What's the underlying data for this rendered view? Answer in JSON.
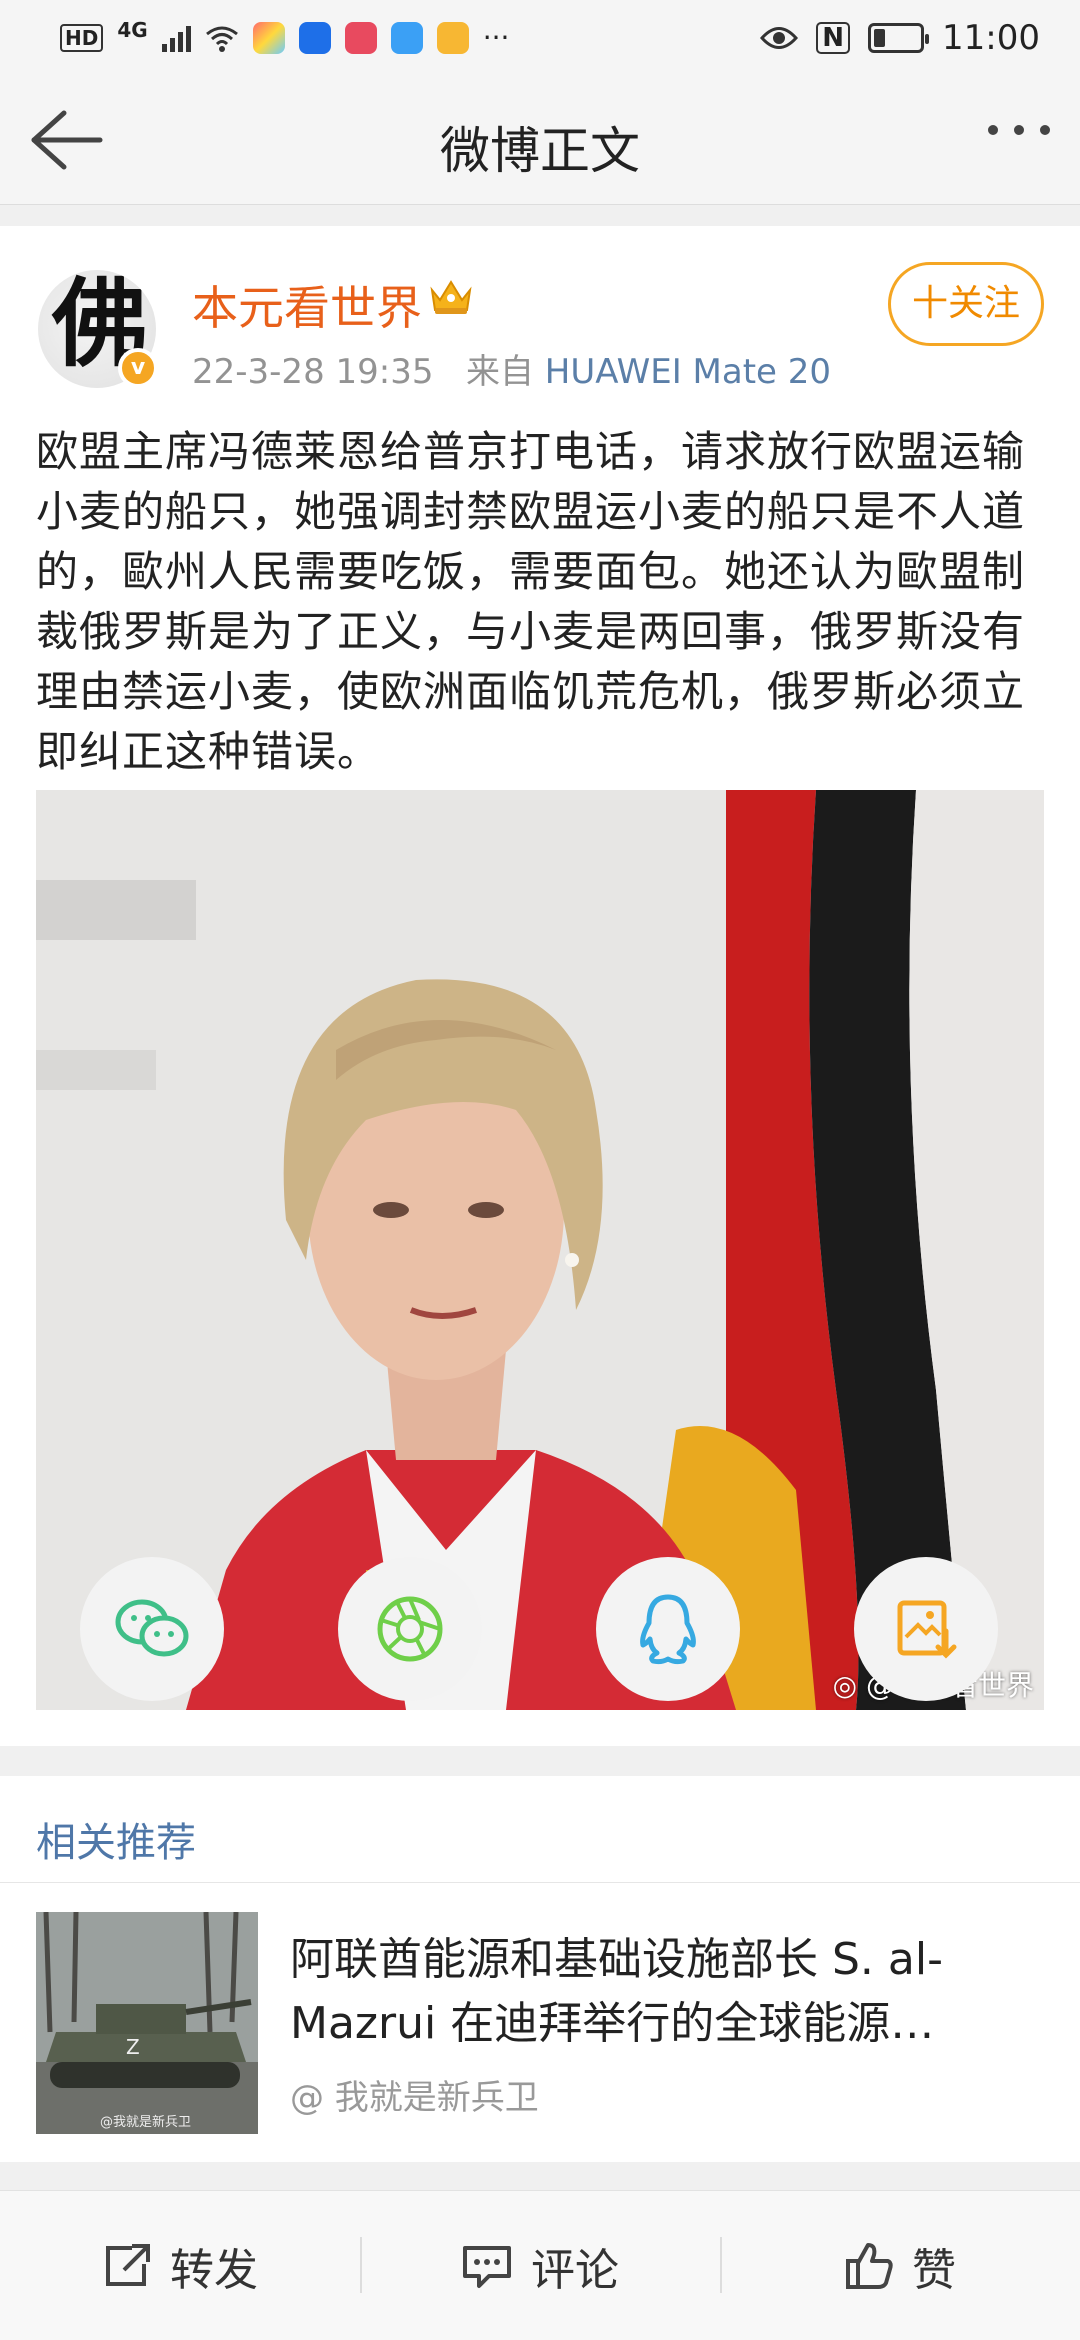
{
  "status_bar": {
    "hd": "HD",
    "network": "4G",
    "more": "···",
    "time": "11:00",
    "nfc": "N",
    "battery_level": 0.25
  },
  "header": {
    "title": "微博正文"
  },
  "post": {
    "author": "本元看世界",
    "verified_badge": "v",
    "timestamp": "22-3-28 19:35",
    "source_prefix": "来自",
    "device": "HUAWEI Mate 20",
    "follow_label": "十关注",
    "text": "欧盟主席冯德莱恩给普京打电话，请求放行欧盟运输小麦的船只，她强调封禁欧盟运小麦的船只是不人道的，歐州人民需要吃饭，需要面包。她还认为歐盟制裁俄罗斯是为了正义，与小麦是两回事，俄罗斯没有理由禁运小麦，使欧洲面临饥荒危机，俄罗斯必须立即纠正这种错误。",
    "image_watermark": "@本元看世界"
  },
  "share_icons": [
    "wechat-icon",
    "moments-icon",
    "qq-icon",
    "save-image-icon"
  ],
  "related": {
    "section_title": "相关推荐",
    "item": {
      "title": "阿联酋能源和基础设施部长 S. al-Mazrui 在迪拜举行的全球能源…",
      "author": "@ 我就是新兵卫",
      "thumb_watermark": "@我就是新兵卫"
    }
  },
  "bottom_bar": {
    "repost": "转发",
    "comment": "评论",
    "like": "赞"
  },
  "colors": {
    "username": "#e8601a",
    "follow": "#f5a623",
    "link": "#4f77a8"
  }
}
